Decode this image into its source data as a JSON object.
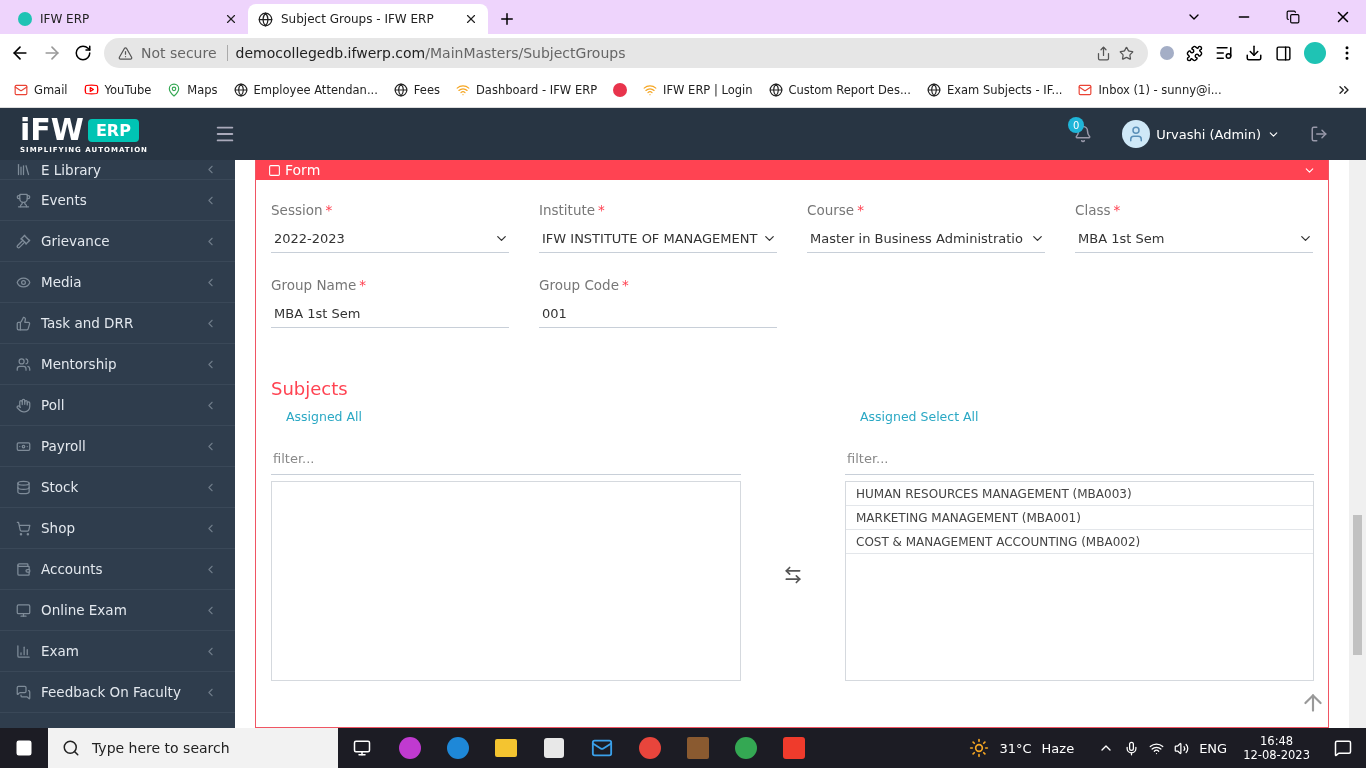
{
  "browser": {
    "tabs": [
      {
        "title": "IFW ERP",
        "selected": false
      },
      {
        "title": "Subject Groups - IFW ERP",
        "selected": true
      }
    ],
    "address": {
      "security": "Not secure",
      "url_host": "democollegedb.ifwerp.com",
      "url_path": "/MainMasters/SubjectGroups"
    },
    "bookmarks": [
      {
        "label": "Gmail",
        "kind": "mail"
      },
      {
        "label": "YouTube",
        "kind": "video"
      },
      {
        "label": "Maps",
        "kind": "map"
      },
      {
        "label": "Employee Attendan...",
        "kind": "site"
      },
      {
        "label": "Fees",
        "kind": "site"
      },
      {
        "label": "Dashboard - IFW ERP",
        "kind": "erp"
      },
      {
        "kind": "badge"
      },
      {
        "label": "IFW ERP | Login",
        "kind": "erp"
      },
      {
        "label": "Custom Report Des...",
        "kind": "site"
      },
      {
        "label": "Exam Subjects - IF...",
        "kind": "site"
      },
      {
        "label": "Inbox (1) - sunny@i...",
        "kind": "mail"
      }
    ]
  },
  "header": {
    "logo_word": "iFW",
    "logo_badge": "ERP",
    "logo_tagline": "SIMPLIFYING AUTOMATION",
    "notifications": "0",
    "user": "Urvashi (Admin)"
  },
  "sidebar": {
    "items": [
      {
        "label": "E Library"
      },
      {
        "label": "Events"
      },
      {
        "label": "Grievance"
      },
      {
        "label": "Media"
      },
      {
        "label": "Task and DRR"
      },
      {
        "label": "Mentorship"
      },
      {
        "label": "Poll"
      },
      {
        "label": "Payroll"
      },
      {
        "label": "Stock"
      },
      {
        "label": "Shop"
      },
      {
        "label": "Accounts"
      },
      {
        "label": "Online Exam"
      },
      {
        "label": "Exam"
      },
      {
        "label": "Feedback On Faculty"
      }
    ]
  },
  "form": {
    "title": "Form",
    "fields": [
      {
        "label": "Session",
        "required_mark": "*",
        "value": "2022-2023",
        "kind": "select"
      },
      {
        "label": "Institute",
        "required_mark": "*",
        "value": "IFW INSTITUTE OF MANAGEMENT",
        "kind": "select"
      },
      {
        "label": "Course",
        "required_mark": "*",
        "value": "Master in Business Administratio",
        "kind": "select"
      },
      {
        "label": "Class",
        "required_mark": "*",
        "value": "MBA 1st Sem",
        "kind": "select"
      },
      {
        "label": "Group Name",
        "required_mark": "*",
        "value": "MBA 1st Sem",
        "kind": "text"
      },
      {
        "label": "Group Code",
        "required_mark": "*",
        "value": "001",
        "kind": "text"
      }
    ],
    "subjects_title": "Subjects",
    "available": {
      "link": "Assigned All",
      "placeholder": "filter..."
    },
    "assigned": {
      "link": "Assigned Select All",
      "placeholder": "filter...",
      "items": [
        "HUMAN RESOURCES MANAGEMENT (MBA003)",
        "MARKETING MANAGEMENT (MBA001)",
        "COST & MANAGEMENT ACCOUNTING (MBA002)"
      ]
    }
  },
  "taskbar": {
    "search_placeholder": "Type here to search",
    "temperature": "31°C",
    "weather": "Haze",
    "language": "ENG",
    "time": "16:48",
    "date": "12-08-2023"
  }
}
